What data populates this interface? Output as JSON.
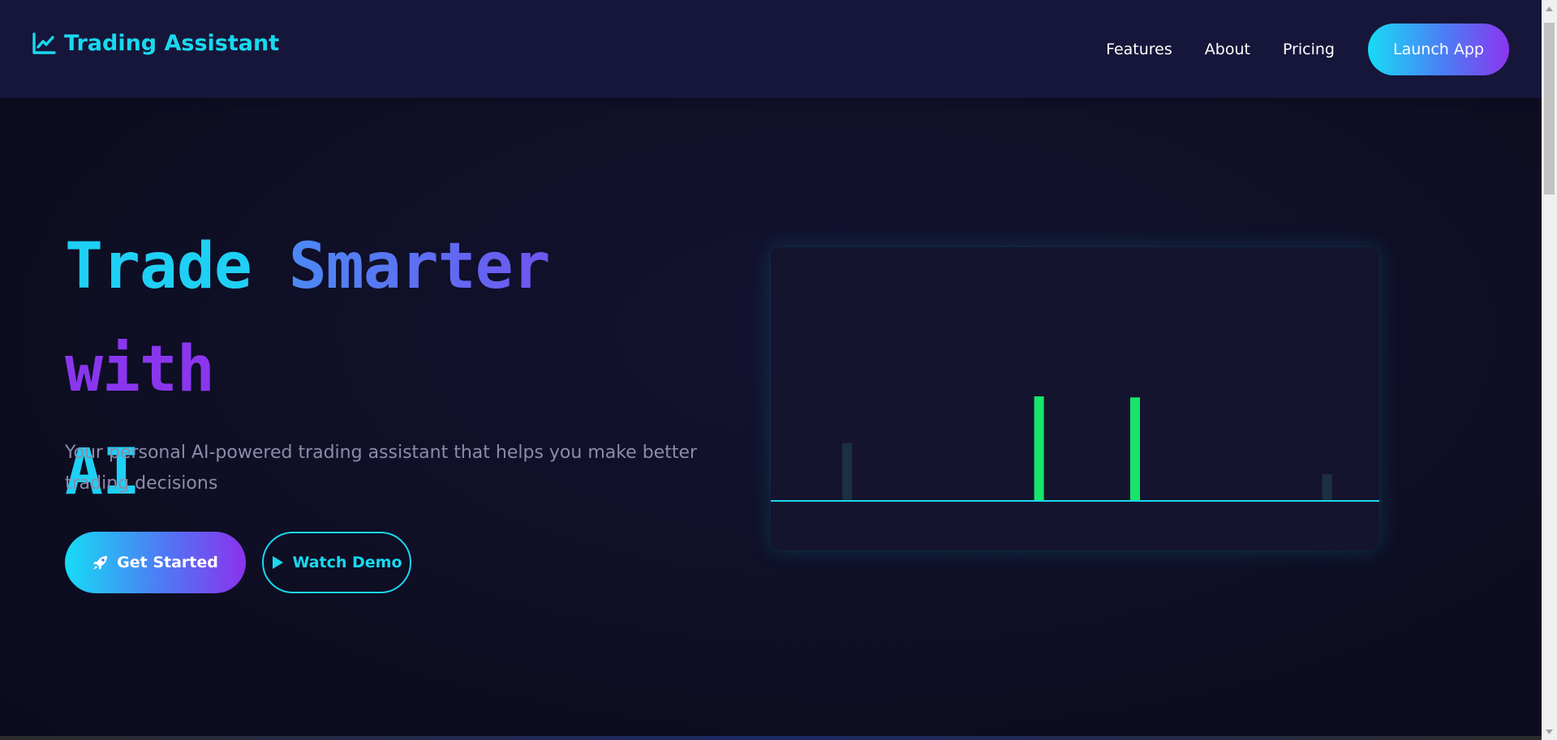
{
  "header": {
    "brand_icon": "chart-line-icon",
    "brand_name": "Trading Assistant",
    "nav": [
      "Features",
      "About",
      "Pricing"
    ],
    "launch_label": "Launch App"
  },
  "hero": {
    "title_parts": [
      "Trade",
      "Smarter",
      "with",
      "AI"
    ],
    "subtitle": "Your personal AI-powered trading assistant that helps you make better trading decisions",
    "primary_button": {
      "icon": "rocket-icon",
      "label": "Get Started"
    },
    "secondary_button": {
      "icon": "play-icon",
      "label": "Watch Demo"
    }
  },
  "chart_data": {
    "type": "bar",
    "series": [
      {
        "values": [
          0,
          0,
          0.55,
          0,
          0,
          0,
          0,
          0,
          0,
          0,
          1.0,
          0,
          0,
          0,
          0.99,
          0,
          0,
          0,
          0,
          0,
          0,
          0,
          0.25,
          0
        ]
      }
    ],
    "colors": {
      "highlight": "#16e56a",
      "faint": "#1c2f45",
      "baseline": "#19d9ee"
    },
    "grid": false
  },
  "colors": {
    "accent_cyan": "#19d9ee",
    "accent_purple": "#8a36ee",
    "background": "#0f0f24",
    "header": "#16163a"
  }
}
